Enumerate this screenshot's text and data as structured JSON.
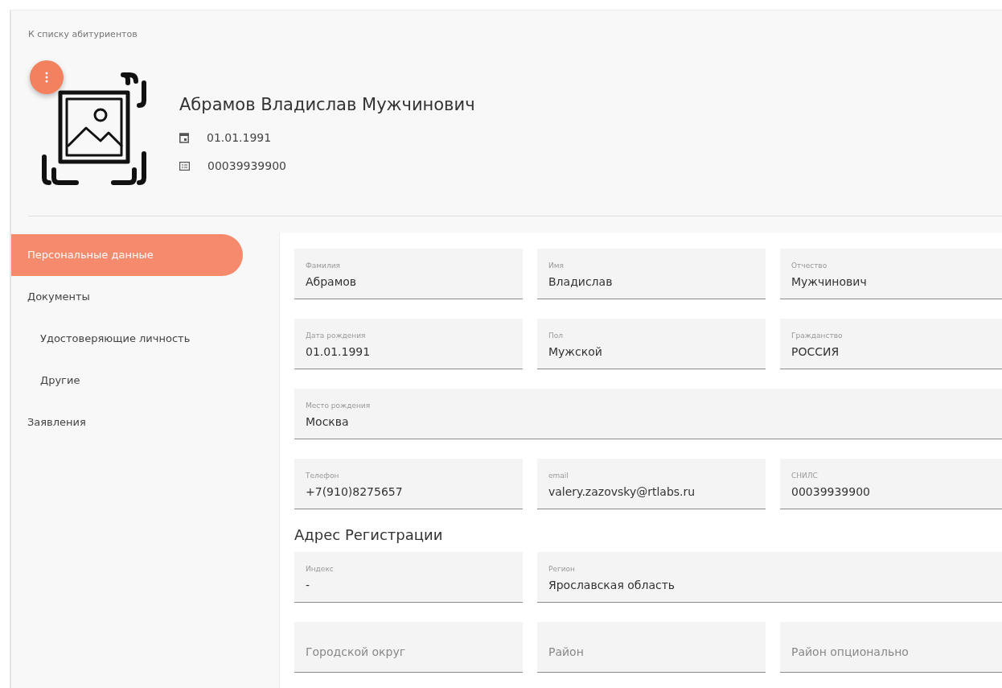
{
  "back_link": "К списку абитуриентов",
  "profile": {
    "name": "Абрамов Владислав Мужчинович",
    "birth_date": "01.01.1991",
    "snils": "00039939900"
  },
  "sidebar": {
    "items": [
      {
        "label": "Персональные данные",
        "selected": true
      },
      {
        "label": "Документы",
        "selected": false,
        "children": [
          {
            "label": "Удостоверяющие личность",
            "selected": false
          },
          {
            "label": "Другие",
            "selected": false
          }
        ]
      },
      {
        "label": "Заявления",
        "selected": false
      }
    ]
  },
  "sections": [
    {
      "rows": [
        [
          {
            "label": "Фамилия",
            "value": "Абрамов"
          },
          {
            "label": "Имя",
            "value": "Владислав"
          },
          {
            "label": "Отчество",
            "value": "Мужчинович"
          }
        ],
        [
          {
            "label": "Дата рождения",
            "value": "01.01.1991"
          },
          {
            "label": "Пол",
            "value": "Мужской"
          },
          {
            "label": "Гражданство",
            "value": "РОССИЯ"
          }
        ],
        [
          {
            "label": "Место рождения",
            "value": "Москва"
          }
        ],
        [
          {
            "label": "Телефон",
            "value": "+7(910)8275657"
          },
          {
            "label": "email",
            "value": "valery.zazovsky@rtlabs.ru"
          },
          {
            "label": "СНИЛС",
            "value": "00039939900"
          }
        ]
      ]
    },
    {
      "title": "Адрес Регистрации",
      "rows": [
        [
          {
            "label": "Индекс",
            "value": "-"
          },
          {
            "label": "Регион",
            "value": "Ярославская область"
          }
        ],
        [
          {
            "placeholder": "Городской округ"
          },
          {
            "placeholder": "Район"
          },
          {
            "placeholder": "Район опционально"
          }
        ]
      ]
    }
  ]
}
